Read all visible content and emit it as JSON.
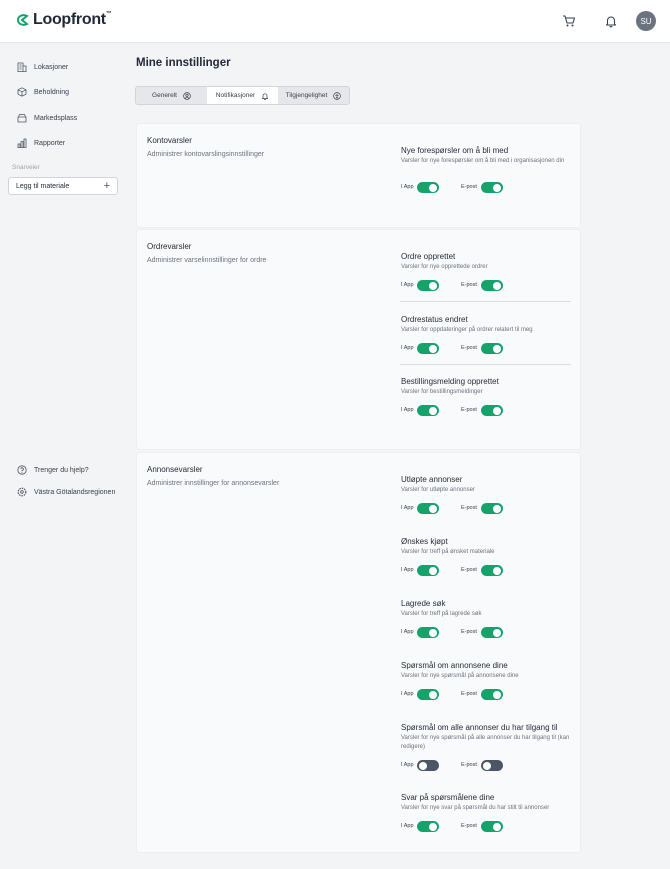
{
  "header": {
    "logo": "Loopfront",
    "logo_tm": "™",
    "cart_icon": "cart-icon",
    "bell_icon": "bell-icon",
    "avatar_initials": "SU"
  },
  "sidebar": {
    "items": [
      {
        "label": "Lokasjoner",
        "icon": "building-icon"
      },
      {
        "label": "Beholdning",
        "icon": "box-icon"
      },
      {
        "label": "Markedsplass",
        "icon": "store-icon"
      },
      {
        "label": "Rapporter",
        "icon": "bar-chart-icon"
      }
    ],
    "shortcuts_label": "Snarveier",
    "shortcut": "Legg til materiale",
    "help": "Trenger du hjelp?",
    "region": "Västra Götalandsregionen"
  },
  "main": {
    "title": "Mine innstillinger",
    "tabs": [
      {
        "label": "Generelt",
        "icon": "user-circle-icon",
        "active": false
      },
      {
        "label": "Notifikasjoner",
        "icon": "bell-icon",
        "active": true
      },
      {
        "label": "Tilgjengelighet",
        "icon": "accessibility-icon",
        "active": false
      }
    ],
    "toggle_labels": {
      "app": "I App",
      "email": "E-post"
    },
    "sections": [
      {
        "title": "Kontovarsler",
        "description": "Administrer kontovarslingsinnstillinger",
        "items": [
          {
            "name": "Nye forespørsler om å bli med",
            "description": "Varsler for nye forespørsler om å bli med i organisasjonen din",
            "app": true,
            "email": true
          }
        ]
      },
      {
        "title": "Ordrevarsler",
        "description": "Administrer varselinnstillinger for ordre",
        "items": [
          {
            "name": "Ordre opprettet",
            "description": "Varsler for nye opprettede ordrer",
            "app": true,
            "email": true
          },
          {
            "name": "Ordrestatus endret",
            "description": "Varsler for oppdateringer på ordrer relatert til meg",
            "app": true,
            "email": true
          },
          {
            "name": "Bestillingsmelding opprettet",
            "description": "Varsler for bestillingsmeldinger",
            "app": true,
            "email": true
          }
        ]
      },
      {
        "title": "Annonsevarsler",
        "description": "Administrer innstillinger for annonsevarsler",
        "items": [
          {
            "name": "Utløpte annonser",
            "description": "Varsler for utløpte annonser",
            "app": true,
            "email": true
          },
          {
            "name": "Ønskes kjøpt",
            "description": "Varsler for treff på ønsket materiale",
            "app": true,
            "email": true
          },
          {
            "name": "Lagrede søk",
            "description": "Varsler for treff på lagrede søk",
            "app": true,
            "email": true
          },
          {
            "name": "Spørsmål om annonsene dine",
            "description": "Varsler for nye spørsmål på annonsene dine",
            "app": true,
            "email": true
          },
          {
            "name": "Spørsmål om alle annonser du har tilgang til",
            "description": "Varsler for nye spørsmål på alle annonser du har tilgang til (kan redigere)",
            "app": false,
            "email": false
          },
          {
            "name": "Svar på spørsmålene dine",
            "description": "Varsler for nye svar på spørsmål du har stilt til annonser",
            "app": true,
            "email": true
          }
        ]
      }
    ]
  },
  "colors": {
    "toggle_on": "#16a36b",
    "toggle_off": "#4b5563",
    "brand": "#16a36b"
  }
}
